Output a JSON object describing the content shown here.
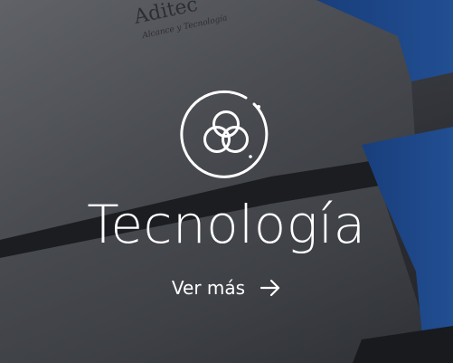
{
  "card": {
    "title": "Tecnología",
    "cta_label": "Ver más",
    "icon": "three-circles-technology-icon",
    "cta_icon": "arrow-right-icon"
  },
  "background": {
    "brand_print": "Aditec",
    "brand_tagline": "Alcance y Tecnología",
    "accent_color": "#1f63c8"
  }
}
